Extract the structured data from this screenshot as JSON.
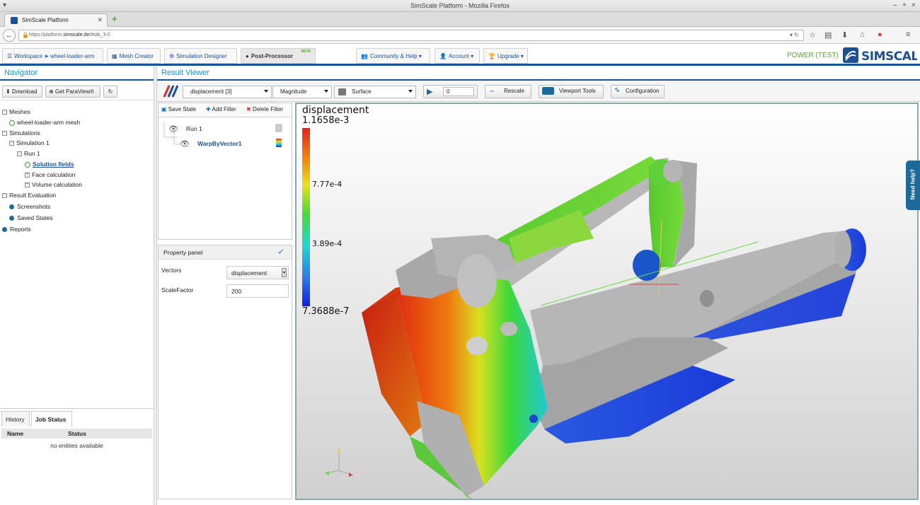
{
  "window": {
    "title": "SimScale Platform - Mozilla Firefox"
  },
  "browser": {
    "tab_title": "SimScale Platform",
    "url_prefix": "https://platform.",
    "url_host": "simscale.de",
    "url_rest": "/#tab_3-0"
  },
  "app": {
    "tabs": [
      {
        "label": "Workspace ➤ wheel-loader-arm"
      },
      {
        "label": "Mesh Creator"
      },
      {
        "label": "Simulation Designer"
      },
      {
        "label": "Post-Processor",
        "badge": "BETA"
      },
      {
        "label": "Community & Help"
      },
      {
        "label": "Account"
      },
      {
        "label": "Upgrade"
      }
    ],
    "plan": "POWER (TEST)",
    "logo_text": "SIMSCALE",
    "accent": "#1d4f91",
    "green": "#5aa531"
  },
  "navigator": {
    "title": "Navigator",
    "buttons": {
      "download": "Download",
      "paraview": "Get ParaView®"
    },
    "tree": {
      "meshes": "Meshes",
      "mesh": "wheel-loader-arm mesh",
      "simulations": "Simulations",
      "sim1": "Simulation 1",
      "run1": "Run 1",
      "solution_fields": "Solution fields",
      "face_calc": "Face calculation",
      "volume_calc": "Volume calculation",
      "result_eval": "Result Evaluation",
      "screenshots": "Screenshots",
      "saved_states": "Saved States",
      "reports": "Reports"
    },
    "bottom": {
      "tab_history": "History",
      "tab_jobs": "Job Status",
      "col_name": "Name",
      "col_status": "Status",
      "empty": "no entities available"
    }
  },
  "viewer": {
    "title": "Result Viewer",
    "field": "displacement [3]",
    "component": "Magnitude",
    "representation": "Surface",
    "frame": "0",
    "buttons": {
      "rescale": "Rescale",
      "viewport_tools": "Viewport Tools",
      "configuration": "Configuration"
    },
    "filters": {
      "save_state": "Save State",
      "add_filter": "Add Filter",
      "delete_filter": "Delete Filter",
      "run": "Run 1",
      "warp": "WarpByVector1"
    },
    "properties": {
      "title": "Property panel",
      "vectors_label": "Vectors",
      "vectors_value": "displacement",
      "scale_label": "ScaleFactor",
      "scale_value": "200"
    },
    "legend": {
      "title": "displacement",
      "max": "1.1658e-3",
      "tick_hi": "7.77e-4",
      "tick_mid": "3.89e-4",
      "min": "7.3688e-7"
    },
    "help_tab": "Need help?"
  }
}
